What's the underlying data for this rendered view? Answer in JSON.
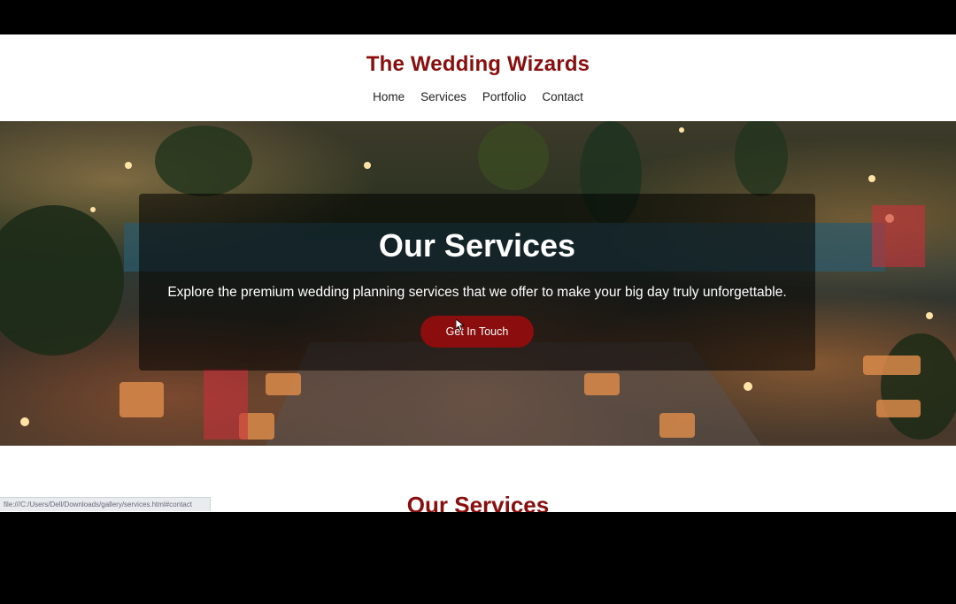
{
  "site": {
    "title": "The Wedding Wizards",
    "nav": [
      "Home",
      "Services",
      "Portfolio",
      "Contact"
    ]
  },
  "hero": {
    "title": "Our Services",
    "text": "Explore the premium wedding planning services that we offer to make your big day truly unforgettable.",
    "cta_label": "Get In Touch"
  },
  "section": {
    "heading": "Our Services"
  },
  "status_bar": {
    "url": "file:///C:/Users/Dell/Downloads/gallery/services.html#contact"
  },
  "colors": {
    "brand": "#8b0d0d",
    "overlay": "rgba(0,0,0,0.55)"
  },
  "icons": {
    "cursor": "mouse-pointer-icon"
  }
}
